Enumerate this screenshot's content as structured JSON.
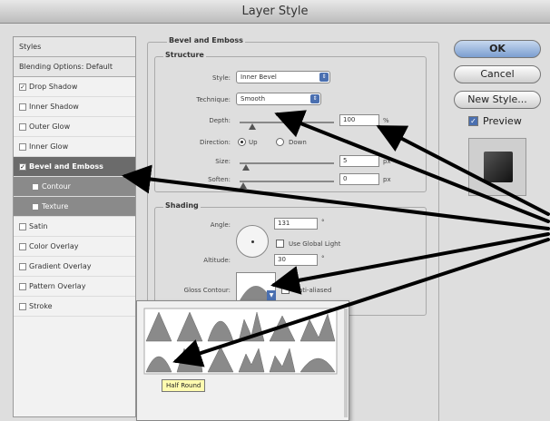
{
  "window": {
    "title": "Layer Style"
  },
  "styles_list": [
    {
      "label": "Styles",
      "kind": "header",
      "checked": null
    },
    {
      "label": "Blending Options: Default",
      "kind": "header",
      "checked": null
    },
    {
      "label": "Drop Shadow",
      "kind": "item",
      "checked": true
    },
    {
      "label": "Inner Shadow",
      "kind": "item",
      "checked": false
    },
    {
      "label": "Outer Glow",
      "kind": "item",
      "checked": false
    },
    {
      "label": "Inner Glow",
      "kind": "item",
      "checked": false
    },
    {
      "label": "Bevel and Emboss",
      "kind": "selected",
      "checked": true
    },
    {
      "label": "Contour",
      "kind": "sub",
      "checked": false
    },
    {
      "label": "Texture",
      "kind": "sub",
      "checked": false
    },
    {
      "label": "Satin",
      "kind": "item",
      "checked": false
    },
    {
      "label": "Color Overlay",
      "kind": "item",
      "checked": false
    },
    {
      "label": "Gradient Overlay",
      "kind": "item",
      "checked": false
    },
    {
      "label": "Pattern Overlay",
      "kind": "item",
      "checked": false
    },
    {
      "label": "Stroke",
      "kind": "item",
      "checked": false
    }
  ],
  "bevel": {
    "title": "Bevel and Emboss",
    "structure": {
      "title": "Structure",
      "style_label": "Style:",
      "style_value": "Inner Bevel",
      "technique_label": "Technique:",
      "technique_value": "Smooth",
      "depth_label": "Depth:",
      "depth_value": "100",
      "depth_unit": "%",
      "depth_level": 0.1,
      "direction_label": "Direction:",
      "dir_up": "Up",
      "dir_down": "Down",
      "size_label": "Size:",
      "size_value": "5",
      "size_unit": "px",
      "size_level": 0.03,
      "soften_label": "Soften:",
      "soften_value": "0",
      "soften_unit": "px",
      "soften_level": 0.0
    },
    "shading": {
      "title": "Shading",
      "angle_label": "Angle:",
      "angle_value": "131",
      "angle_unit": "°",
      "global_light": "Use Global Light",
      "altitude_label": "Altitude:",
      "altitude_value": "30",
      "altitude_unit": "°",
      "gloss_label": "Gloss Contour:",
      "anti_aliased": "Anti-aliased"
    }
  },
  "buttons": {
    "ok": "OK",
    "cancel": "Cancel",
    "new_style": "New Style...",
    "preview": "Preview"
  },
  "popup": {
    "tooltip": "Half Round"
  },
  "colors": {
    "arrow": "#000000",
    "selected_row": "#6b6b6b",
    "accent": "#4a6fb0"
  }
}
